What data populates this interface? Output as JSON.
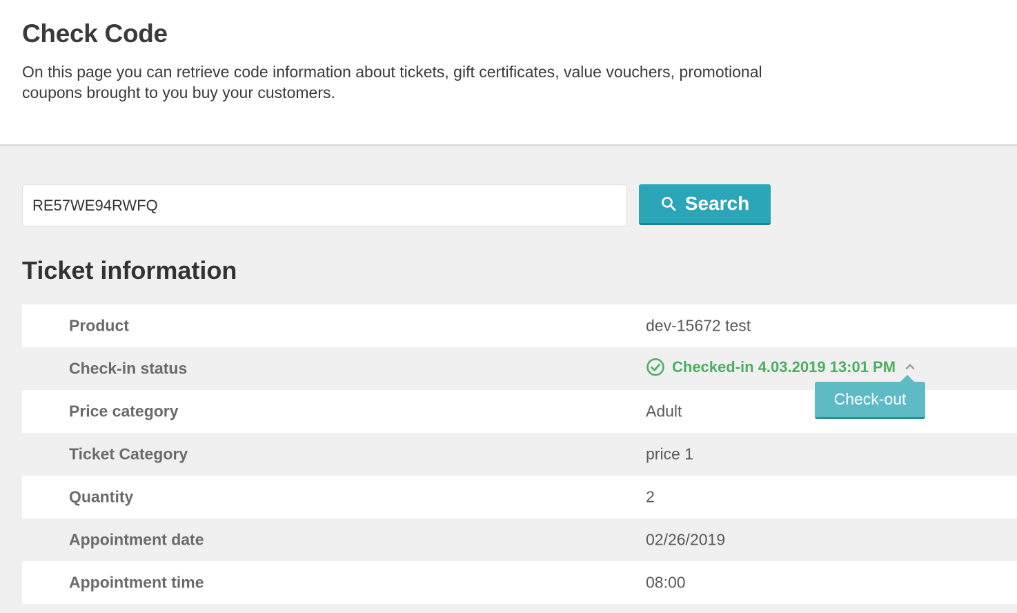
{
  "header": {
    "title": "Check Code",
    "description": "On this page you can retrieve code information about tickets, gift certificates, value vouchers, promotional coupons brought to you buy your customers."
  },
  "search": {
    "value": "RE57WE94RWFQ",
    "button_label": "Search",
    "button_icon": "search-icon"
  },
  "ticket": {
    "section_title": "Ticket information",
    "rows": [
      {
        "label": "Product",
        "value": "dev-15672 test"
      },
      {
        "label": "Check-in status",
        "value": "Checked-in 4.03.2019 13:01 PM"
      },
      {
        "label": "Price category",
        "value": "Adult"
      },
      {
        "label": "Ticket Category",
        "value": "price 1"
      },
      {
        "label": "Quantity",
        "value": "2"
      },
      {
        "label": "Appointment date",
        "value": "02/26/2019"
      },
      {
        "label": "Appointment time",
        "value": "08:00"
      }
    ],
    "checkout_label": "Check-out"
  },
  "colors": {
    "accent": "#2ba6b8",
    "status_green": "#4cae5f",
    "popover": "#5ebac5"
  }
}
